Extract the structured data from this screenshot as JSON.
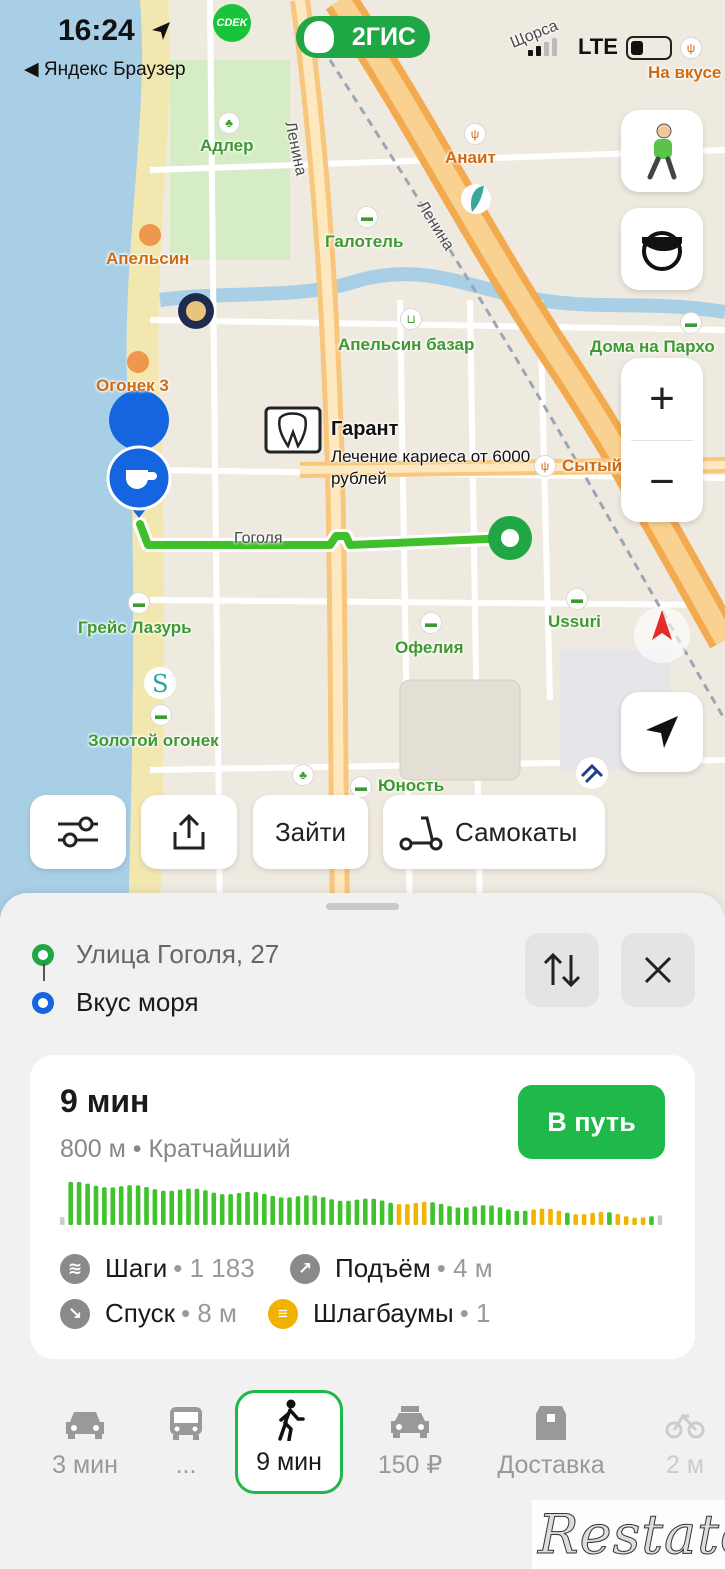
{
  "status_bar": {
    "time": "16:24",
    "back_app": "◀ Яндекс Браузер",
    "network": "LTE",
    "brand": "2ГИС",
    "cdek": "CDEK"
  },
  "map": {
    "labels": {
      "adler": "Адлер",
      "anait": "Анаит",
      "galotel": "Галотель",
      "apelsin": "Апельсин",
      "apelsin_bazar": "Апельсин базар",
      "doma": "Дома на Пархо",
      "ogonek": "Огонек 3",
      "na_vkuse": "На вкусе",
      "garant_title": "Гарант",
      "garant_desc": "Лечение кариеса от 6000 рублей",
      "syty": "Сытый",
      "gogolya": "Гоголя",
      "grace": "Грейс Лазурь",
      "ofelia": "Офелия",
      "ussuri": "Ussuri",
      "zolotoy": "Золотой огонек",
      "yunost": "Юность",
      "lenina_1": "Ленина",
      "lenina_2": "Ленина",
      "shchorsa": "Щорса",
      "na_edge": "На"
    }
  },
  "map_buttons": {
    "login": "Зайти",
    "scooters": "Самокаты"
  },
  "route_points": {
    "from": "Улица Гоголя, 27",
    "to": "Вкус моря"
  },
  "route_card": {
    "eta": "9 мин",
    "summary": "800 м • Кратчайший",
    "go": "В путь",
    "stats": {
      "steps_label": "Шаги",
      "steps_value": "• 1 183",
      "ascent_label": "Подъём",
      "ascent_value": "• 4 м",
      "descent_label": "Спуск",
      "descent_value": "• 8 м",
      "barriers_label": "Шлагбаумы",
      "barriers_value": "• 1"
    }
  },
  "transport_modes": [
    {
      "name": "car",
      "label": "3 мин"
    },
    {
      "name": "bus",
      "label": "..."
    },
    {
      "name": "walk",
      "label": "9 мин",
      "active": true
    },
    {
      "name": "taxi",
      "label": "150 ₽"
    },
    {
      "name": "delivery",
      "label": "Доставка"
    },
    {
      "name": "bike",
      "label": "2 м"
    }
  ],
  "colors": {
    "accent_green": "#1fb84a",
    "route_green": "#3fbf2a",
    "route_start": "#1fa745",
    "destination_blue": "#1565e0",
    "elevation_green": "#3fc22c",
    "elevation_yellow": "#f0b400"
  },
  "watermark": "Restate"
}
